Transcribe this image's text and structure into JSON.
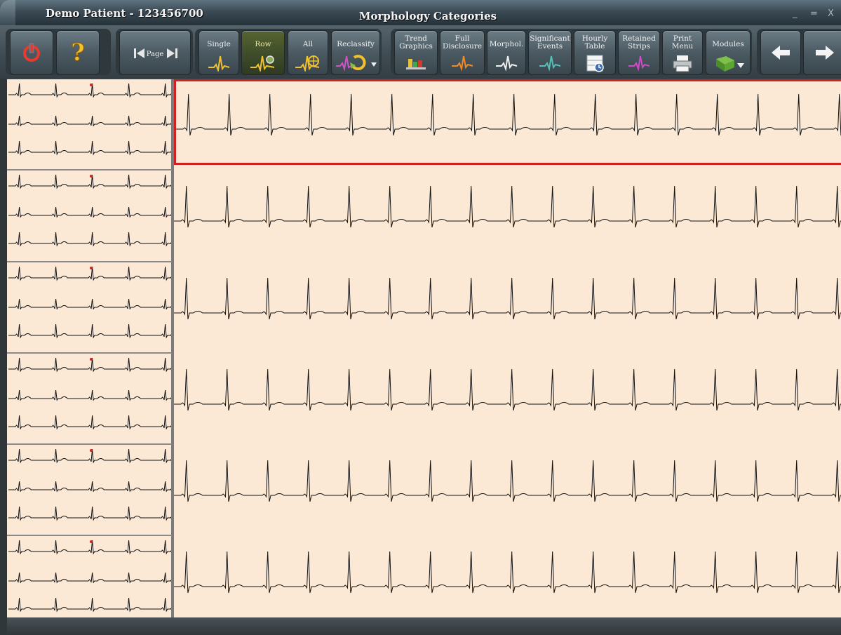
{
  "window": {
    "patient_title": "Demo Patient - 123456700",
    "screen_title": "Morphology Categories",
    "controls": [
      "_",
      "=",
      "X"
    ]
  },
  "toolbar": {
    "power_icon": "power-icon",
    "help_icon": "help-icon",
    "page_label": "Page",
    "single_label": "Single",
    "row_label": "Row",
    "all_label": "All",
    "reclassify_label": "Reclassify",
    "trend_graphics_label": "Trend\nGraphics",
    "full_disclosure_label": "Full\nDisclosure",
    "morphol_label": "Morphol.",
    "significant_events_label": "Significant\nEvents",
    "hourly_table_label": "Hourly\nTable",
    "retained_strips_label": "Retained\nStrips",
    "print_menu_label": "Print\nMenu",
    "modules_label": "Modules",
    "back_icon": "arrow-left-icon",
    "forward_icon": "arrow-right-icon"
  },
  "morphology": {
    "category_count": 6,
    "selected_row": 1,
    "colors": {
      "background": "#fbe9d6",
      "trace": "#111111",
      "selection": "#d21f1f",
      "marker": "#d21f1f"
    }
  }
}
